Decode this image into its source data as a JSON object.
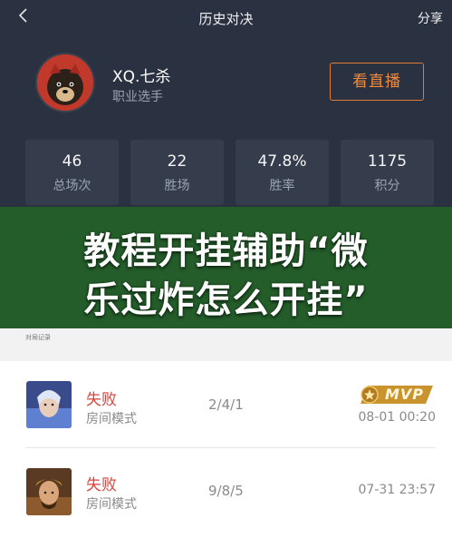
{
  "header": {
    "back_icon": "chevron-left-icon",
    "title": "历史对决",
    "share_label": "分享"
  },
  "profile": {
    "name": "XQ.七杀",
    "role": "职业选手",
    "live_button": "看直播"
  },
  "stats": [
    {
      "value": "46",
      "label": "总场次"
    },
    {
      "value": "22",
      "label": "胜场"
    },
    {
      "value": "47.8%",
      "label": "胜率"
    },
    {
      "value": "1175",
      "label": "积分"
    }
  ],
  "banner": {
    "line1": "教程开挂辅助“微",
    "line2": "乐过炸怎么开挂”"
  },
  "records_label": "对局记录",
  "matches": [
    {
      "result": "失败",
      "mode": "房间模式",
      "kda": "2/4/1",
      "time": "08-01 00:20",
      "badge": "MVP"
    },
    {
      "result": "失败",
      "mode": "房间模式",
      "kda": "9/8/5",
      "time": "07-31 23:57"
    }
  ],
  "colors": {
    "header_bg": "#2a3140",
    "accent": "#e07a34",
    "loss": "#d6453d",
    "banner": "#245c2a",
    "mvp_gold": "#c9942e"
  }
}
